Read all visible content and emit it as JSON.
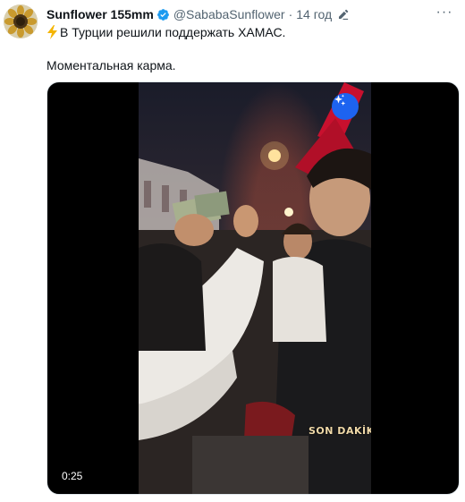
{
  "tweet": {
    "author_name": "Sunflower 155mm",
    "author_handle": "@SababaSunflower",
    "separator": "·",
    "time": "14 год",
    "text_line1": "В Турции решили поддержать ХАМАС.",
    "text_line2": "Моментальная карма.",
    "more_label": "···"
  },
  "media": {
    "type": "video",
    "duration": "0:25",
    "watermark": "SON DAKİKA"
  },
  "icons": {
    "avatar": "sunflower-avatar",
    "verified": "verified-badge-icon",
    "edit": "edit-pencil-icon",
    "bolt": "lightning-bolt-emoji",
    "sparkle": "sparkle-icon",
    "more": "more-options-icon"
  },
  "colors": {
    "verified_blue": "#1d9bf0",
    "secondary_text": "#536471",
    "sparkle_button": "#1d63f0",
    "bolt_yellow": "#f4b400"
  }
}
